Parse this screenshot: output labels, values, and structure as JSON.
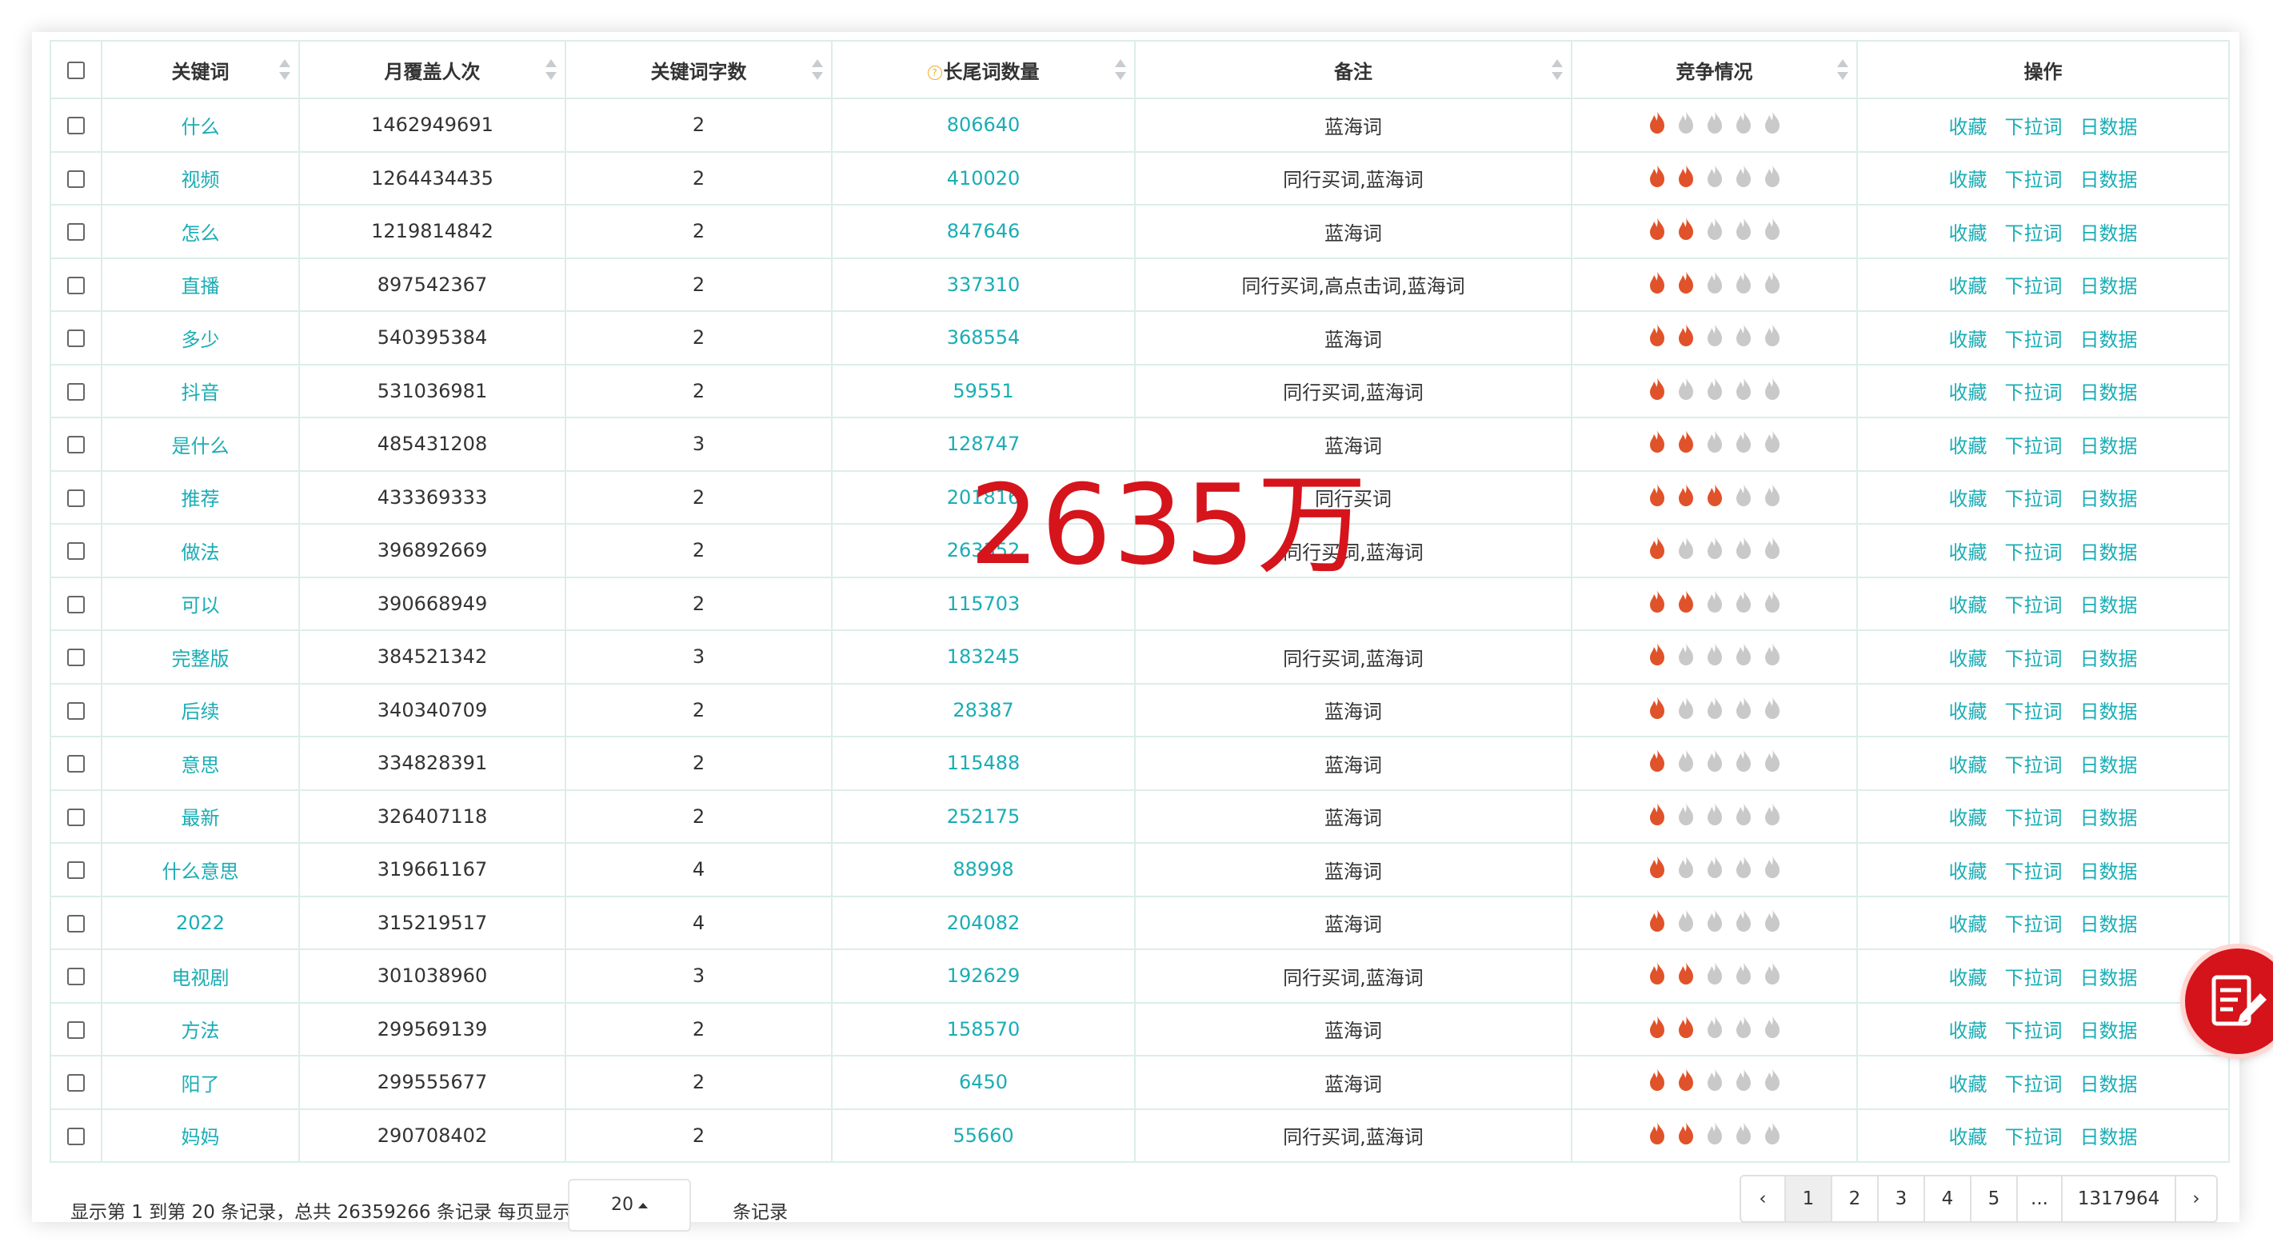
{
  "table": {
    "headers": [
      "关键词",
      "月覆盖人次",
      "关键词字数",
      "长尾词数量",
      "备注",
      "竞争情况",
      "操作"
    ],
    "rows": [
      {
        "keyword": "什么",
        "coverage": "1462949691",
        "chars": "2",
        "longtail": "806640",
        "note": "蓝海词",
        "competition": 1
      },
      {
        "keyword": "视频",
        "coverage": "1264434435",
        "chars": "2",
        "longtail": "410020",
        "note": "同行买词,蓝海词",
        "competition": 2
      },
      {
        "keyword": "怎么",
        "coverage": "1219814842",
        "chars": "2",
        "longtail": "847646",
        "note": "蓝海词",
        "competition": 2
      },
      {
        "keyword": "直播",
        "coverage": "897542367",
        "chars": "2",
        "longtail": "337310",
        "note": "同行买词,高点击词,蓝海词",
        "competition": 2
      },
      {
        "keyword": "多少",
        "coverage": "540395384",
        "chars": "2",
        "longtail": "368554",
        "note": "蓝海词",
        "competition": 2
      },
      {
        "keyword": "抖音",
        "coverage": "531036981",
        "chars": "2",
        "longtail": "59551",
        "note": "同行买词,蓝海词",
        "competition": 1
      },
      {
        "keyword": "是什么",
        "coverage": "485431208",
        "chars": "3",
        "longtail": "128747",
        "note": "蓝海词",
        "competition": 2
      },
      {
        "keyword": "推荐",
        "coverage": "433369333",
        "chars": "2",
        "longtail": "201816",
        "note": "同行买词",
        "competition": 3
      },
      {
        "keyword": "做法",
        "coverage": "396892669",
        "chars": "2",
        "longtail": "263352",
        "note": "同行买词,蓝海词",
        "competition": 1
      },
      {
        "keyword": "可以",
        "coverage": "390668949",
        "chars": "2",
        "longtail": "115703",
        "note": "",
        "competition": 2
      },
      {
        "keyword": "完整版",
        "coverage": "384521342",
        "chars": "3",
        "longtail": "183245",
        "note": "同行买词,蓝海词",
        "competition": 1
      },
      {
        "keyword": "后续",
        "coverage": "340340709",
        "chars": "2",
        "longtail": "28387",
        "note": "蓝海词",
        "competition": 1
      },
      {
        "keyword": "意思",
        "coverage": "334828391",
        "chars": "2",
        "longtail": "115488",
        "note": "蓝海词",
        "competition": 1
      },
      {
        "keyword": "最新",
        "coverage": "326407118",
        "chars": "2",
        "longtail": "252175",
        "note": "蓝海词",
        "competition": 1
      },
      {
        "keyword": "什么意思",
        "coverage": "319661167",
        "chars": "4",
        "longtail": "88998",
        "note": "蓝海词",
        "competition": 1
      },
      {
        "keyword": "2022",
        "coverage": "315219517",
        "chars": "4",
        "longtail": "204082",
        "note": "蓝海词",
        "competition": 1
      },
      {
        "keyword": "电视剧",
        "coverage": "301038960",
        "chars": "3",
        "longtail": "192629",
        "note": "同行买词,蓝海词",
        "competition": 2
      },
      {
        "keyword": "方法",
        "coverage": "299569139",
        "chars": "2",
        "longtail": "158570",
        "note": "蓝海词",
        "competition": 2
      },
      {
        "keyword": "阳了",
        "coverage": "299555677",
        "chars": "2",
        "longtail": "6450",
        "note": "蓝海词",
        "competition": 2
      },
      {
        "keyword": "妈妈",
        "coverage": "290708402",
        "chars": "2",
        "longtail": "55660",
        "note": "同行买词,蓝海词",
        "competition": 2
      }
    ],
    "actions": [
      "收藏",
      "下拉词",
      "日数据"
    ],
    "competition_max": 5
  },
  "watermark": "2635万",
  "footer": {
    "info_before": "显示第 1 到第 20 条记录，总共 26359266 条记录 每页显示",
    "page_size": "20",
    "info_after": "条记录"
  },
  "pagination": {
    "prev": "‹",
    "pages": [
      "1",
      "2",
      "3",
      "4",
      "5",
      "...",
      "1317964"
    ],
    "active": "1",
    "next": "›"
  },
  "colors": {
    "accent": "#1aadb5",
    "flame_active": "#e0522a",
    "flame_inactive": "#c9c9c9",
    "border": "#dbeee7",
    "watermark": "#d5141b",
    "fab": "#d5131a"
  },
  "icons": {
    "competition": "flame-icon",
    "fab": "edit-note-icon",
    "longtail_hint": "question-circle-icon"
  }
}
